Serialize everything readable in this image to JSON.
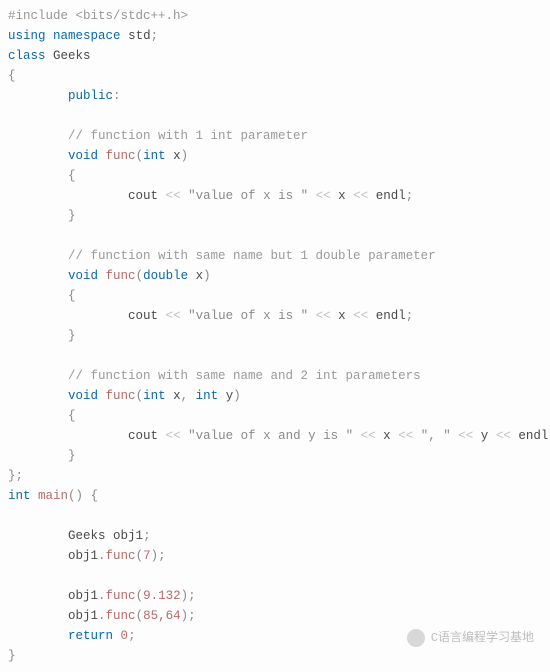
{
  "code": {
    "include_kw": "#include",
    "include_hdr": "<bits/stdc++.h>",
    "using": "using",
    "namespace": "namespace",
    "std": "std",
    "class_kw": "class",
    "class_name": "Geeks",
    "public_kw": "public",
    "comment1": "// function with 1 int parameter",
    "void1": "void",
    "func1": "func",
    "int1": "int",
    "x1": "x",
    "cout1": "cout",
    "str1": "\"value of x is \"",
    "xx1": "x",
    "endl1": "endl",
    "comment2": "// function with same name but 1 double parameter",
    "void2": "void",
    "func2": "func",
    "double2": "double",
    "x2": "x",
    "cout2": "cout",
    "str2": "\"value of x is \"",
    "xx2": "x",
    "endl2": "endl",
    "comment3": "// function with same name and 2 int parameters",
    "void3": "void",
    "func3": "func",
    "int3a": "int",
    "x3": "x",
    "int3b": "int",
    "y3": "y",
    "cout3": "cout",
    "str3a": "\"value of x and y is \"",
    "xx3": "x",
    "str3b": "\", \"",
    "yy3": "y",
    "endl3": "endl",
    "int_main": "int",
    "main": "main",
    "geeks_t": "Geeks",
    "obj1": "obj1",
    "obja": "obj1",
    "funca": "func",
    "arga": "7",
    "objb": "obj1",
    "funcb": "func",
    "argb": "9.132",
    "objc": "obj1",
    "funcc": "func",
    "argc": "85,64",
    "return_kw": "return",
    "ret0": "0"
  },
  "watermark": "C语言编程学习基地"
}
